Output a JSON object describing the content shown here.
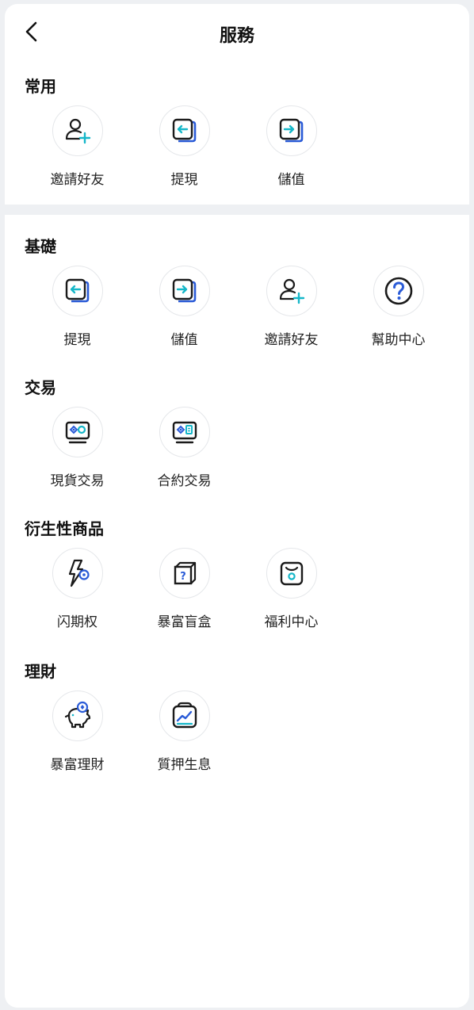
{
  "header": {
    "title": "服務"
  },
  "sections": [
    {
      "title": "常用",
      "items": [
        {
          "label": "邀請好友",
          "icon": "add-user-icon"
        },
        {
          "label": "提現",
          "icon": "withdraw-icon"
        },
        {
          "label": "儲值",
          "icon": "deposit-icon"
        }
      ]
    },
    {
      "title": "基礎",
      "items": [
        {
          "label": "提現",
          "icon": "withdraw-icon"
        },
        {
          "label": "儲值",
          "icon": "deposit-icon"
        },
        {
          "label": "邀請好友",
          "icon": "add-user-icon"
        },
        {
          "label": "幫助中心",
          "icon": "help-icon"
        }
      ]
    },
    {
      "title": "交易",
      "items": [
        {
          "label": "現貨交易",
          "icon": "spot-trade-icon"
        },
        {
          "label": "合約交易",
          "icon": "contract-trade-icon"
        }
      ]
    },
    {
      "title": "衍生性商品",
      "items": [
        {
          "label": "闪期权",
          "icon": "flash-option-icon"
        },
        {
          "label": "暴富盲盒",
          "icon": "mystery-box-icon"
        },
        {
          "label": "福利中心",
          "icon": "welfare-bag-icon"
        }
      ]
    },
    {
      "title": "理財",
      "items": [
        {
          "label": "暴富理財",
          "icon": "piggy-bank-icon"
        },
        {
          "label": "質押生息",
          "icon": "staking-chart-icon"
        }
      ]
    }
  ],
  "colors": {
    "accent_cyan": "#16b7c9",
    "accent_blue": "#2a5bd7",
    "icon_dark": "#1a1a1a"
  }
}
